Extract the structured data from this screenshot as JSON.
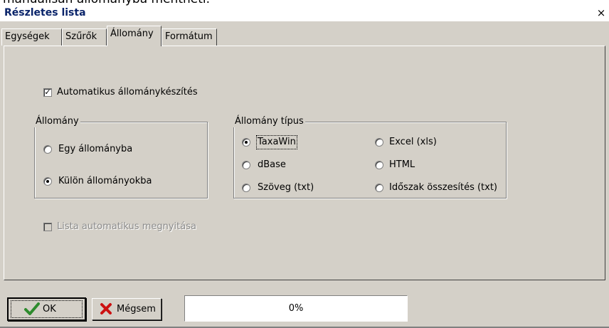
{
  "caption_text": "manuálisan állományba mentheti.",
  "window": {
    "title": "Részletes lista",
    "close_glyph": "×"
  },
  "tabs": [
    {
      "label": "Egységek",
      "active": false
    },
    {
      "label": "Szűrők",
      "active": false
    },
    {
      "label": "Állomány",
      "active": true
    },
    {
      "label": "Formátum",
      "active": false
    }
  ],
  "auto_file": {
    "label": "Automatikus állománykészítés",
    "checked": true
  },
  "file_group": {
    "title": "Állomány",
    "options": [
      {
        "label": "Egy állományba",
        "selected": false
      },
      {
        "label": "Külön állományokba",
        "selected": true
      }
    ]
  },
  "type_group": {
    "title": "Állomány típus",
    "options": [
      {
        "label": "TaxaWin",
        "selected": true
      },
      {
        "label": "dBase",
        "selected": false
      },
      {
        "label": "Szöveg (txt)",
        "selected": false
      },
      {
        "label": "Excel (xls)",
        "selected": false
      },
      {
        "label": "HTML",
        "selected": false
      },
      {
        "label": "Időszak összesítés (txt)",
        "selected": false
      }
    ]
  },
  "auto_open": {
    "label": "Lista automatikus megnyitása",
    "checked": false,
    "disabled": true
  },
  "buttons": {
    "ok": "OK",
    "cancel": "Mégsem"
  },
  "progress": {
    "text": "0%",
    "fraction": 0
  },
  "colors": {
    "face": "#d4d0c8",
    "title_text": "#0a246a",
    "ok_check": "#2e8b2e",
    "cancel_x": "#cc1111"
  },
  "icons": {
    "ok": "check-icon",
    "cancel": "x-icon"
  }
}
